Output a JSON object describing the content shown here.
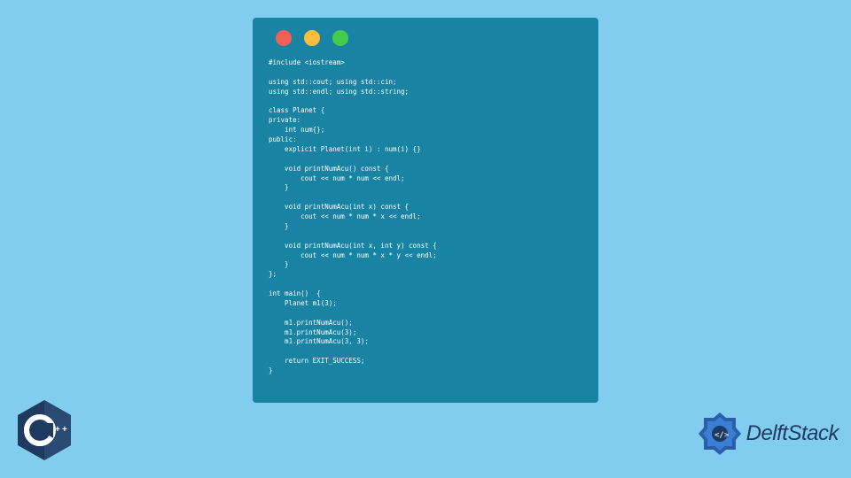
{
  "window": {
    "dots": [
      "red",
      "yellow",
      "green"
    ]
  },
  "code": "#include <iostream>\n\nusing std::cout; using std::cin;\nusing std::endl; using std::string;\n\nclass Planet {\nprivate:\n    int num{};\npublic:\n    explicit Planet(int i) : num(i) {}\n\n    void printNumAcu() const {\n        cout << num * num << endl;\n    }\n\n    void printNumAcu(int x) const {\n        cout << num * num * x << endl;\n    }\n\n    void printNumAcu(int x, int y) const {\n        cout << num * num * x * y << endl;\n    }\n};\n\nint main()  {\n    Planet m1(3);\n\n    m1.printNumAcu();\n    m1.printNumAcu(3);\n    m1.printNumAcu(3, 3);\n\n    return EXIT_SUCCESS;\n}",
  "branding": {
    "cpp_label": "C++",
    "site_name": "DelftStack"
  }
}
